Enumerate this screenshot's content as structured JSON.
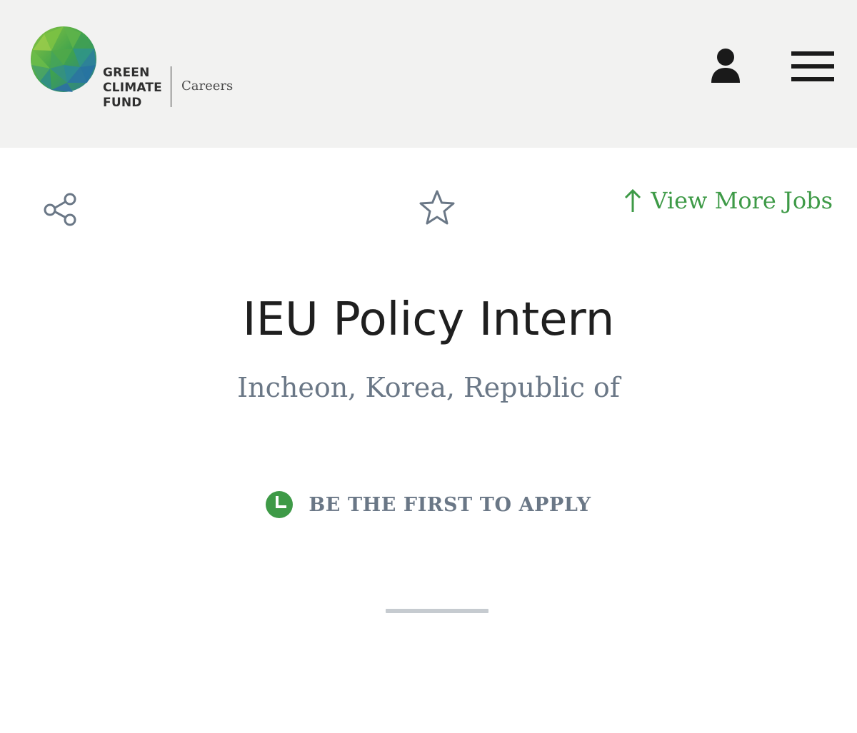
{
  "header": {
    "logo_lines": [
      "GREEN",
      "CLIMATE",
      "FUND"
    ],
    "section_label": "Careers",
    "profile_icon": "user-icon",
    "menu_icon": "hamburger-menu-icon"
  },
  "actions": {
    "share_icon": "share-icon",
    "favorite_icon": "star-icon",
    "view_more_label": "View More Jobs",
    "view_more_icon": "arrow-up-icon"
  },
  "job": {
    "title": "IEU Policy Intern",
    "location": "Incheon, Korea, Republic of",
    "apply_status": "BE THE FIRST TO APPLY",
    "status_icon": "clock-icon"
  },
  "colors": {
    "accent_green": "#3e9a47",
    "muted_text": "#6a7786",
    "header_bg": "#f2f2f1",
    "title_text": "#1f1f1f"
  }
}
